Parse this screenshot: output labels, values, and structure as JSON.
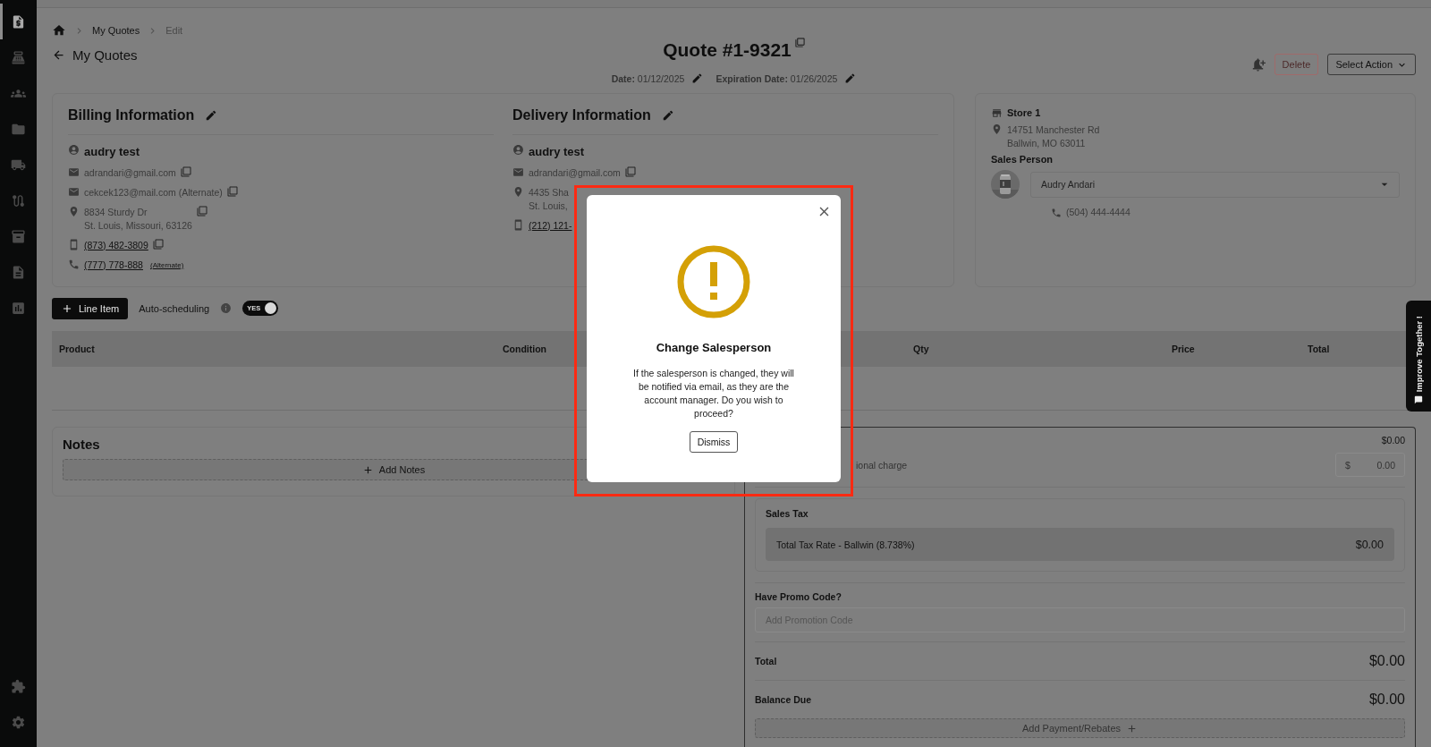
{
  "sidebar": {
    "items": [
      {
        "kind": "quote",
        "selected": true
      },
      {
        "kind": "register",
        "selected": false
      },
      {
        "kind": "customers",
        "selected": false
      },
      {
        "kind": "folder",
        "selected": false
      },
      {
        "kind": "truck",
        "selected": false
      },
      {
        "kind": "route",
        "selected": false
      },
      {
        "kind": "box",
        "selected": false
      },
      {
        "kind": "document",
        "selected": false
      },
      {
        "kind": "chart",
        "selected": false
      }
    ],
    "bottom_items": [
      {
        "kind": "puzzle",
        "selected": false
      },
      {
        "kind": "settings",
        "selected": false
      }
    ]
  },
  "breadcrumb": [
    "My Quotes",
    "Edit"
  ],
  "back_link": "My Quotes",
  "title": "Quote #1-9321",
  "dates": [
    {
      "label": "Date:",
      "value": "01/12/2025"
    },
    {
      "label": "Expiration Date:",
      "value": "01/26/2025"
    }
  ],
  "actions": {
    "delete": "Delete",
    "select": "Select Action"
  },
  "contacts": [
    {
      "heading": "Billing Information",
      "name": "audry test",
      "items": [
        {
          "kind": "email",
          "lines": [
            "adrandari@gmail.com"
          ],
          "copy": true
        },
        {
          "kind": "email",
          "lines": [
            "cekcek123@mail.com (Alternate)"
          ],
          "copy": true
        },
        {
          "kind": "address",
          "lines": [
            "8834 Sturdy Dr",
            "St. Louis, Missouri, 63126"
          ],
          "copy": true
        },
        {
          "kind": "mobile",
          "lines": [
            "(873) 482-3809"
          ],
          "copy": true
        },
        {
          "kind": "phone",
          "lines": [
            "(777) 778-888"
          ],
          "note": "(Alternate)",
          "copy": false
        }
      ]
    },
    {
      "heading": "Delivery Information",
      "name": "audry test",
      "items": [
        {
          "kind": "email",
          "lines": [
            "adrandari@gmail.com"
          ],
          "copy": true
        },
        {
          "kind": "address",
          "lines": [
            "4435 Sha",
            "St. Louis,"
          ],
          "copy": false
        },
        {
          "kind": "mobile",
          "lines": [
            "(212) 121-"
          ],
          "copy": false
        }
      ]
    }
  ],
  "store": {
    "name": "Store 1",
    "address": [
      "14751 Manchester Rd",
      "Ballwin, MO 63011"
    ],
    "sales_person_label": "Sales Person",
    "sales_person": "Audry Andari",
    "phone": "(504) 444-4444"
  },
  "line_item_button": "Line Item",
  "auto_scheduling": {
    "label": "Auto-scheduling",
    "toggle": "YES",
    "on": true
  },
  "table": {
    "columns": [
      "Product",
      "Condition",
      "Qty",
      "Price",
      "Total"
    ]
  },
  "notes": {
    "title": "Notes",
    "add": "Add Notes"
  },
  "summary": {
    "subtotal": "$0.00",
    "charge_label": "ional charge",
    "charge_prefix": "$",
    "charge_value": "0.00",
    "sales_tax": {
      "title": "Sales Tax",
      "label": "Total Tax Rate - Ballwin (8.738%)",
      "amount": "$0.00"
    },
    "promo": {
      "label": "Have Promo Code?",
      "placeholder": "Add Promotion Code"
    },
    "total": {
      "label": "Total",
      "amount": "$0.00"
    },
    "balance": {
      "label": "Balance Due",
      "amount": "$0.00"
    },
    "add_payment": "Add Payment/Rebates"
  },
  "dialog": {
    "title": "Change Salesperson",
    "message": "If the salesperson is changed, they will be notified via email, as they are the account manager. Do you wish to proceed?",
    "button": "Dismiss"
  },
  "feedback_tab": "Improve Together !"
}
